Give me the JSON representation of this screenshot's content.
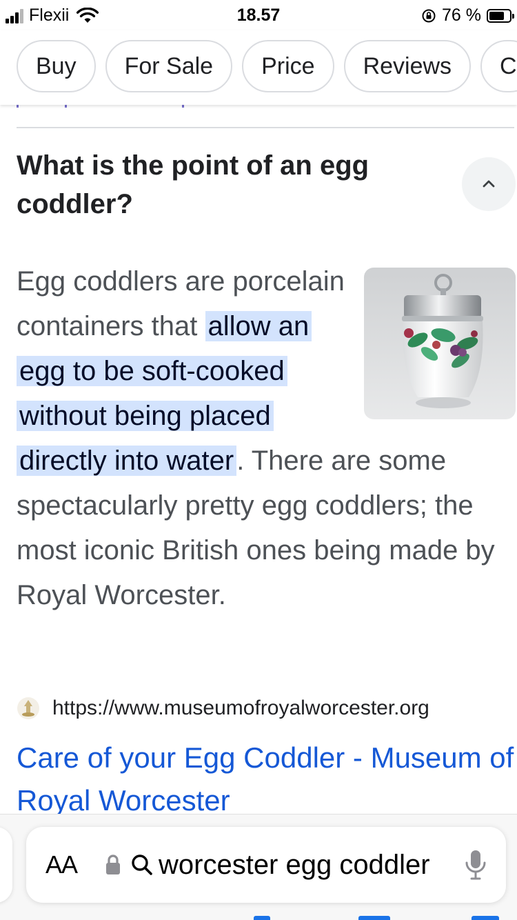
{
  "status_bar": {
    "carrier": "Flexii",
    "time": "18.57",
    "battery_percent": "76 %",
    "battery_level": 0.76,
    "signal_bars_filled": 3,
    "signal_bars_total": 4,
    "icons": [
      "signal-icon",
      "wifi-icon",
      "rotation-lock-icon",
      "battery-icon"
    ]
  },
  "chips": [
    "Buy",
    "For Sale",
    "Price",
    "Reviews",
    "C"
  ],
  "faq": {
    "question": "What is the point of an egg coddler?",
    "answer_before": "Egg coddlers are porcelain containers that ",
    "answer_highlight": "allow an egg to be soft-cooked without being placed directly into water",
    "answer_after": ". There are some spectacularly pretty egg coddlers; the most iconic British ones being made by Royal Worcester.",
    "image_icon": "egg-coddler-image"
  },
  "source": {
    "url": "https://www.museumofroyalworcester.org",
    "title": "Care of your Egg Coddler - Museum of Royal Worcester"
  },
  "address_bar": {
    "text_size_label": "AA",
    "query": "worcester egg coddler"
  },
  "colors": {
    "link": "#1558d6",
    "highlight": "#d3e3fd",
    "chip_border": "#dadce0"
  }
}
